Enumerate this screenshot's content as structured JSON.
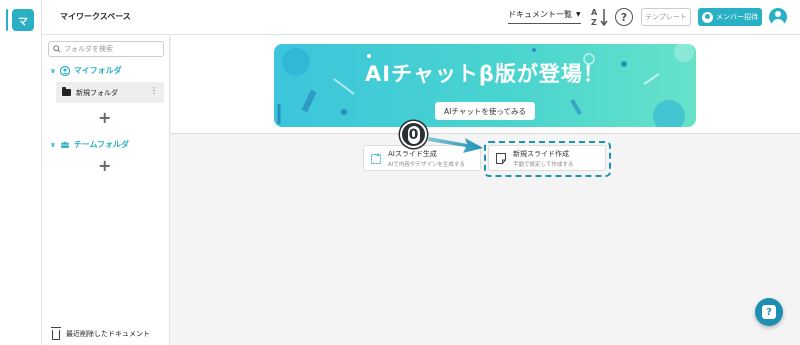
{
  "workspace": {
    "avatar_initial": "マ",
    "title": "マイワークスペース"
  },
  "header": {
    "doc_select": "ドキュメント一覧",
    "template_label": "テンプレート",
    "member_invite_label": "メンバー招待",
    "icons": [
      "sort-az-icon",
      "help-icon",
      "user-icon"
    ]
  },
  "sidebar": {
    "search_placeholder": "フォルダを検索",
    "my_folder_label": "マイフォルダ",
    "folders": [
      {
        "label": "新規フォルダ"
      }
    ],
    "team_folder_label": "チームフォルダ",
    "add_symbol": "+",
    "trash_label": "最近削除したドキュメント"
  },
  "banner": {
    "title": "AIチャットβ版が登場！",
    "button_label": "AIチャットを使ってみる"
  },
  "cards": {
    "ai_slide": {
      "title": "AIスライド生成",
      "subtitle": "AIで内容やデザインを生成する"
    },
    "new_slide": {
      "title": "新規スライド作成",
      "subtitle": "手動で設定して作成する"
    }
  },
  "annotation": {
    "step_number": "0"
  },
  "help_fab_symbol": "?",
  "colors": {
    "accent": "#2ab0c4",
    "highlight": "#1a94b6",
    "fab": "#1e8fb3"
  }
}
